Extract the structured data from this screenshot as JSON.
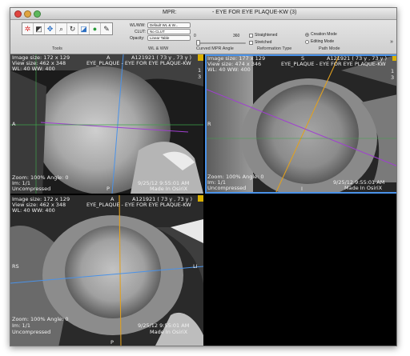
{
  "window": {
    "title_left": "MPR:",
    "title_right": "- EYE FOR EYE PLAQUE-KW (3)"
  },
  "toolbar": {
    "tools": [
      {
        "name": "color-lut-icon",
        "glyph": "✲"
      },
      {
        "name": "window-level-icon",
        "glyph": "◩"
      },
      {
        "name": "move-icon",
        "glyph": "✥"
      },
      {
        "name": "zoom-icon",
        "glyph": "⌕"
      },
      {
        "name": "rotate-icon",
        "glyph": "↻"
      },
      {
        "name": "curved-path-icon",
        "glyph": "◪"
      },
      {
        "name": "circle-tool-icon",
        "glyph": "●"
      },
      {
        "name": "pen-tool-icon",
        "glyph": "✎"
      }
    ],
    "sections": {
      "tools": "Tools",
      "wlww": "WL & WW",
      "curved": "Curved MPR Angle",
      "reformation": "Reformation Type",
      "path": "Path Mode"
    },
    "wlww_label": "WL/WW:",
    "wlww_value": "Default WL & W...",
    "clut_label": "CLUT:",
    "clut_value": "No CLUT",
    "opacity_label": "Opacity:",
    "opacity_value": "Linear Table",
    "angle_min": "0",
    "angle_max": "360",
    "angle_value": 0,
    "straightened": "Straightened",
    "stretched": "Stretched",
    "creation_mode": "Creation Mode",
    "editing_mode": "Editing Mode",
    "overflow": "»"
  },
  "views": {
    "tl": {
      "line1": "Image size: 172 x 129",
      "line2": "View size: 462 x 348",
      "line3": "WL: 40 WW: 400",
      "patient": "A121921 ( 73 y , 73 y )",
      "series": "EYE_PLAQUE - EYE FOR EYE PLAQUE-KW",
      "top": "A",
      "left": "A",
      "bottom": "P",
      "right_num": "1",
      "right_num2": "3",
      "zoom": "Zoom: 100% Angle: 0",
      "im": "Im: 1/1",
      "comp": "Uncompressed",
      "date": "9/25/12 9:55:01 AM",
      "made": "Made In OsiriX"
    },
    "tr": {
      "line1": "Image size: 177 x 129",
      "line2": "View size: 474 x 346",
      "line3": "WL: 40 WW: 400",
      "patient": "A121921 ( 73 y , 73 y )",
      "series": "EYE_PLAQUE - EYE FOR EYE PLAQUE-KW",
      "top": "S",
      "left": "R",
      "bottom": "I",
      "right_num": "1",
      "right_num2": "3",
      "zoom": "Zoom: 100% Angle: 0",
      "im": "Im: 1/1",
      "comp": "Uncompressed",
      "date": "9/25/12 9:55:01 AM",
      "made": "Made In OsiriX"
    },
    "bl": {
      "line1": "Image size: 172 x 129",
      "line2": "View size: 462 x 348",
      "line3": "WL: 40 WW: 400",
      "patient": "A121921 ( 73 y , 73 y )",
      "series": "EYE_PLAQUE - EYE FOR EYE PLAQUE-KW",
      "top": "A",
      "left": "RS",
      "bottom": "P",
      "right": "LI",
      "zoom": "Zoom: 100% Angle: 0",
      "im": "Im: 1/1",
      "comp": "Uncompressed",
      "date": "9/25/12 9:55:01 AM",
      "made": "Made In OsiriX"
    }
  },
  "colors": {
    "axial_line": "#4a92e8",
    "sagittal_line": "#e0a020",
    "coronal_line": "#a040d0",
    "selected": "#4a92e8",
    "marker": "#d9b000"
  }
}
